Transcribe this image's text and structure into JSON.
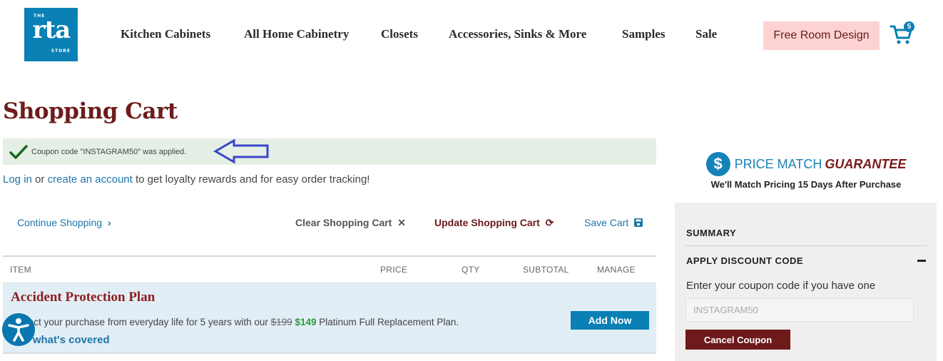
{
  "header": {
    "logo": {
      "top": "THE",
      "main": "rta",
      "bottom": "STORE"
    },
    "nav": [
      {
        "label": "Kitchen Cabinets"
      },
      {
        "label": "All Home Cabinetry"
      },
      {
        "label": "Closets"
      },
      {
        "label": "Accessories, Sinks & More"
      },
      {
        "label": "Samples"
      },
      {
        "label": "Sale"
      }
    ],
    "free_design_label": "Free Room Design",
    "cart_icon": "shopping-cart-icon",
    "cart_count": "5"
  },
  "page": {
    "title": "Shopping Cart",
    "coupon_message": "Coupon code \"INSTAGRAM50\" was applied.",
    "login_link": "Log in",
    "login_or": " or ",
    "create_account_link": "create an account",
    "login_rest": " to get loyalty rewards and for easy order tracking!"
  },
  "actions": {
    "continue": "Continue Shopping",
    "continue_icon": "›",
    "clear": "Clear Shopping Cart",
    "clear_icon": "✕",
    "update": "Update Shopping Cart",
    "update_icon": "⟳",
    "save": "Save Cart",
    "save_icon": "floppy-disk-icon"
  },
  "table": {
    "headers": [
      "ITEM",
      "PRICE",
      "QTY",
      "SUBTOTAL",
      "MANAGE"
    ]
  },
  "protection_plan": {
    "title": "Accident Protection Plan",
    "desc_before": "Protect your purchase from everyday life for 5 years with our ",
    "old_price": "$199",
    "new_price": "$149",
    "desc_after": " Platinum Full Replacement Plan.",
    "link": "See what's covered",
    "button": "Add Now"
  },
  "price_match": {
    "icon": "$",
    "title": "PRICE MATCH",
    "title_emphasis": "GUARANTEE",
    "subtitle": "We'll Match Pricing 15 Days After Purchase"
  },
  "summary": {
    "title": "SUMMARY",
    "discount_title": "APPLY DISCOUNT CODE",
    "discount_label": "Enter your coupon code if you have one",
    "discount_value": "INSTAGRAM50",
    "cancel_button": "Cancel Coupon"
  },
  "colors": {
    "brand_blue": "#0a80b5",
    "maroon": "#6e1c1c",
    "success_bg": "#e5efe5",
    "annotation_arrow": "#3b46c9"
  }
}
